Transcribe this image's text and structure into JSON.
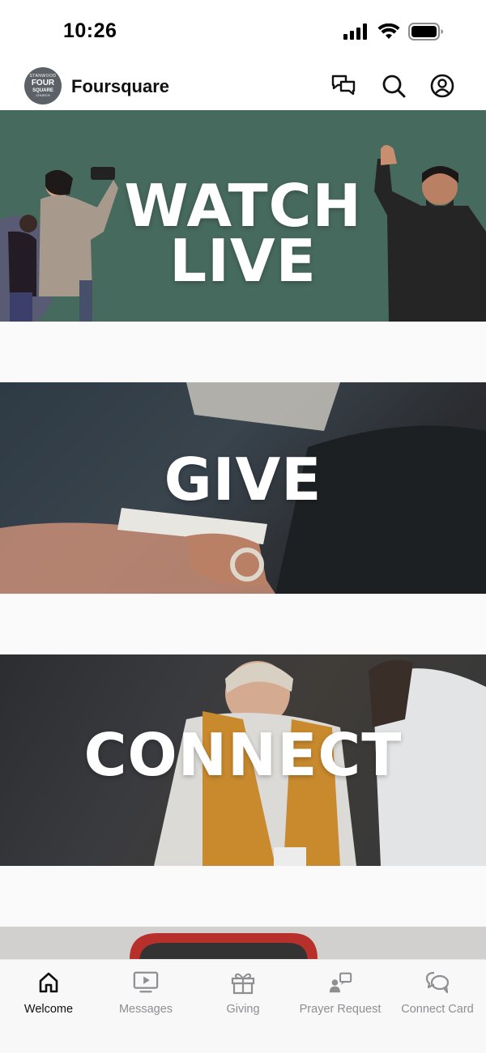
{
  "status_bar": {
    "time": "10:26"
  },
  "header": {
    "logo_text": [
      "STANWOOD",
      "FOUR",
      "SQUARE",
      "CHURCH"
    ],
    "title": "Foursquare"
  },
  "banners": [
    {
      "label_lines": [
        "WATCH",
        "LIVE"
      ]
    },
    {
      "label_lines": [
        "GIVE"
      ]
    },
    {
      "label_lines": [
        "CONNECT"
      ]
    }
  ],
  "tabs": [
    {
      "label": "Welcome",
      "icon": "home-icon",
      "active": true
    },
    {
      "label": "Messages",
      "icon": "play-screen-icon",
      "active": false
    },
    {
      "label": "Giving",
      "icon": "gift-icon",
      "active": false
    },
    {
      "label": "Prayer Request",
      "icon": "prayer-request-icon",
      "active": false
    },
    {
      "label": "Connect Card",
      "icon": "chat-bubbles-icon",
      "active": false
    }
  ],
  "colors": {
    "watch_banner_bg": "#476a5e",
    "tab_active": "#111111",
    "tab_inactive": "#8e8e93"
  }
}
